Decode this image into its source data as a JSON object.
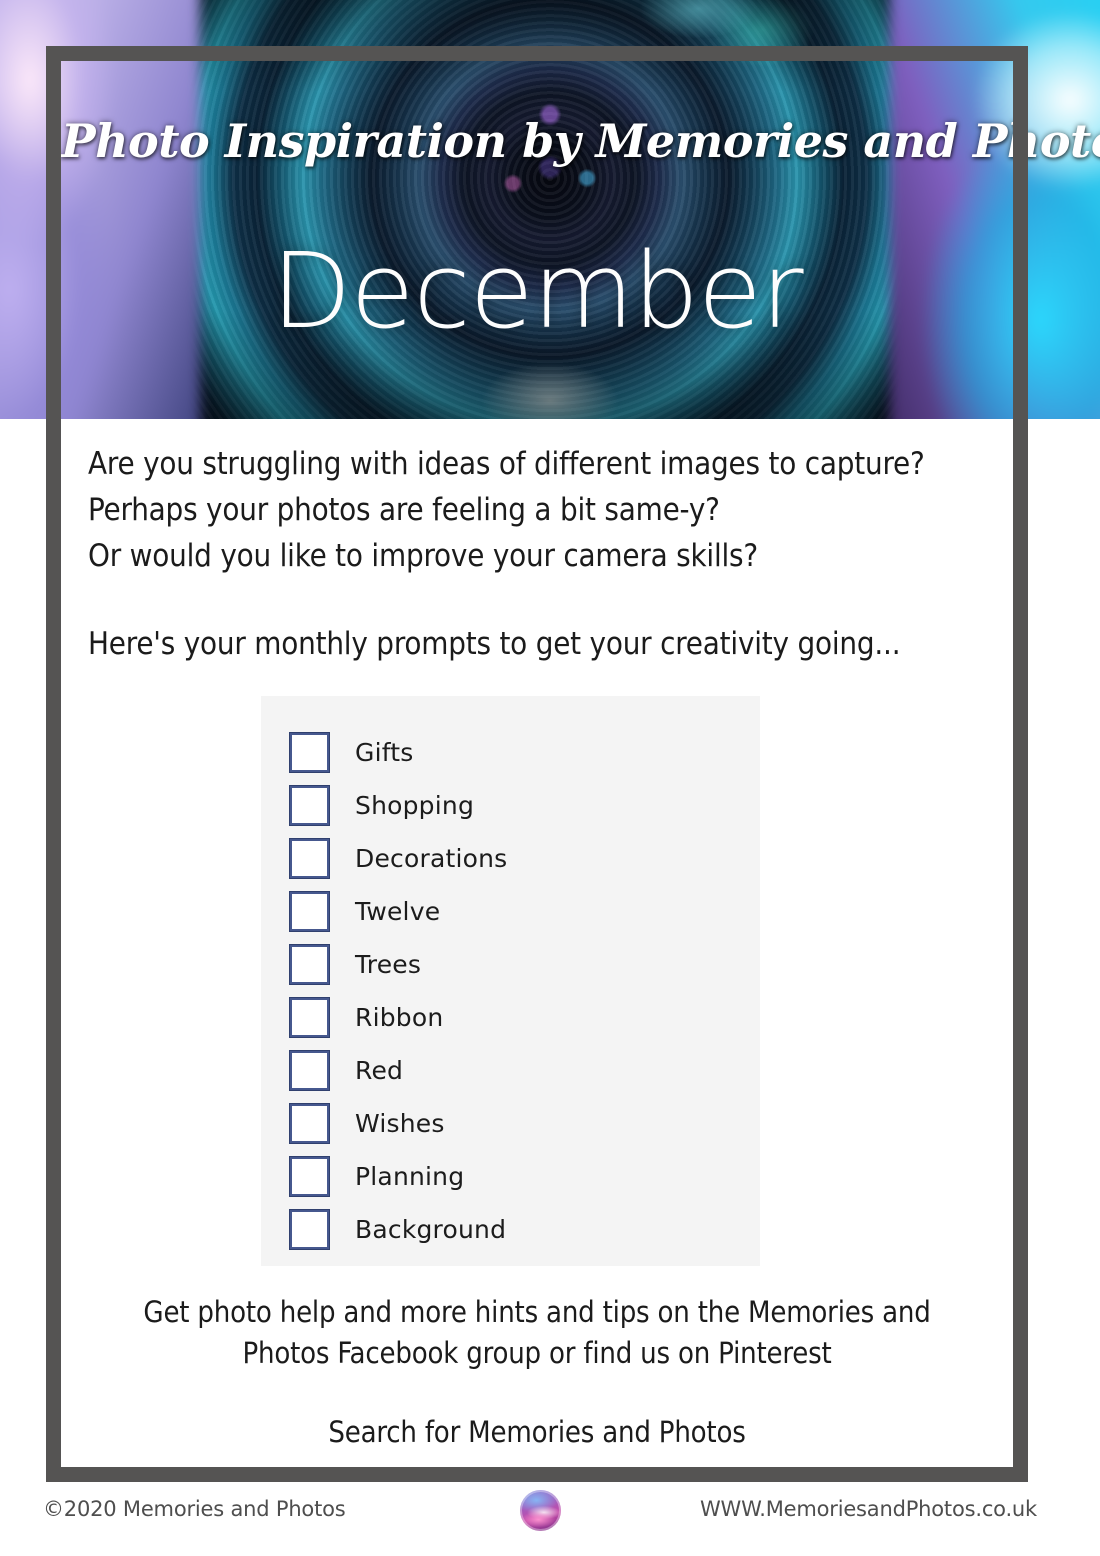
{
  "header": {
    "brand_title": "Photo Inspiration by Memories and Photos",
    "month": "December"
  },
  "intro": {
    "line1": "Are you struggling with ideas of different images to capture?",
    "line2": "Perhaps your photos are feeling a bit same-y?",
    "line3": "Or would you like to improve your camera skills?",
    "line4": "Here's your monthly prompts to get your creativity going..."
  },
  "checklist": {
    "items": [
      {
        "label": "Gifts",
        "checked": false
      },
      {
        "label": "Shopping",
        "checked": false
      },
      {
        "label": "Decorations",
        "checked": false
      },
      {
        "label": "Twelve",
        "checked": false
      },
      {
        "label": "Trees",
        "checked": false
      },
      {
        "label": "Ribbon",
        "checked": false
      },
      {
        "label": "Red",
        "checked": false
      },
      {
        "label": "Wishes",
        "checked": false
      },
      {
        "label": "Planning",
        "checked": false
      },
      {
        "label": "Background",
        "checked": false
      }
    ]
  },
  "outro": {
    "line1": "Get photo help and more hints and tips on the Memories and",
    "line2": "Photos Facebook group or find us on Pinterest",
    "line3": "Search for Memories and Photos"
  },
  "footer": {
    "copyright": "©2020 Memories and Photos",
    "url": "WWW.MemoriesandPhotos.co.uk",
    "logo_icon": "memories-and-photos-logo-icon"
  },
  "colors": {
    "frame": "#555453",
    "panel_bg": "#f4f4f4",
    "checkbox_border": "#46588e",
    "text": "#1b1b1b",
    "footer_text": "#4e4e4e"
  }
}
